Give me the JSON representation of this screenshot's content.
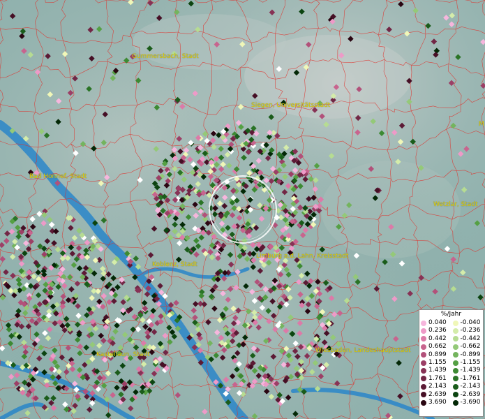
{
  "cities": [
    {
      "name": "Gummersbach, Stadt"
    },
    {
      "name": "Siegen, Universitätsstadt"
    },
    {
      "name": "Bad Honnef, Stadt"
    },
    {
      "name": "Wetzlar, Stadt"
    },
    {
      "name": "Koblenz, Stadt"
    },
    {
      "name": "Limburg a.d. Lahn, Kreisstadt"
    },
    {
      "name": "Kastellaun, Stadt"
    },
    {
      "name": "Wiesbaden, Landeshauptstadt"
    }
  ],
  "legend": {
    "title": "%/Jahr",
    "positive": [
      {
        "label": "0.040",
        "color": "#f6b6dd"
      },
      {
        "label": "0.236",
        "color": "#ee9ac8"
      },
      {
        "label": "0.442",
        "color": "#dc7aa8"
      },
      {
        "label": "0.662",
        "color": "#c8648e"
      },
      {
        "label": "0.899",
        "color": "#b2517a"
      },
      {
        "label": "1.155",
        "color": "#9c3f66"
      },
      {
        "label": "1.439",
        "color": "#873255"
      },
      {
        "label": "1.761",
        "color": "#722645"
      },
      {
        "label": "2.143",
        "color": "#5c1a35"
      },
      {
        "label": "2.639",
        "color": "#460f25"
      },
      {
        "label": "3.690",
        "color": "#2a0612"
      }
    ],
    "negative": [
      {
        "label": "-0.040",
        "color": "#f0f7b8"
      },
      {
        "label": "-0.236",
        "color": "#d4ecaa"
      },
      {
        "label": "-0.442",
        "color": "#b6dc92"
      },
      {
        "label": "-0.662",
        "color": "#94c978"
      },
      {
        "label": "-0.899",
        "color": "#74b45e"
      },
      {
        "label": "-1.155",
        "color": "#55a044"
      },
      {
        "label": "-1.439",
        "color": "#3d8a33"
      },
      {
        "label": "-1.761",
        "color": "#2a7426"
      },
      {
        "label": "-2.143",
        "color": "#1a5c1a"
      },
      {
        "label": "-2.639",
        "color": "#0c4410"
      },
      {
        "label": "-3.690",
        "color": "#032806"
      }
    ]
  },
  "edge_label": "M",
  "colors": {
    "border": "#e0302a",
    "river": "#2a86c9",
    "city_label": "#e8d000"
  }
}
